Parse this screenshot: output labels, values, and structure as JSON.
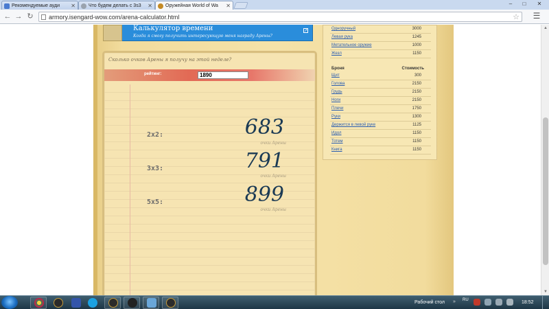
{
  "tabs": [
    {
      "label": "Рекомендуемые ауди",
      "favicon_color": "#4a7bd0"
    },
    {
      "label": "Что будем делать с 3s3",
      "favicon_color": "#9aa3ae"
    },
    {
      "label": "Оружейная World of Wa",
      "favicon_color": "#c48a25"
    }
  ],
  "window_controls": {
    "minimize": "–",
    "maximize": "□",
    "close": "✕"
  },
  "toolbar": {
    "back": "←",
    "forward": "→",
    "reload": "↻",
    "star": "☆",
    "wrench": "🔧",
    "url": "armory.isengard-wow.com/arena-calculator.html"
  },
  "header": {
    "title": "Калькулятор времени",
    "subtitle": "Когда я смогу получить интересующую меня награду Арены?",
    "external_icon": "↗"
  },
  "calculator": {
    "question": "Сколько очков Арены я получу на этой неделе?",
    "rating_label": "рейтинг:",
    "rating_value": "1890",
    "unit": "очки Арены",
    "brackets": [
      {
        "label": "2x2:",
        "points": "683"
      },
      {
        "label": "3x3:",
        "points": "791"
      },
      {
        "label": "5x5:",
        "points": "899"
      }
    ]
  },
  "weapons": [
    {
      "name": "Одноручный",
      "cost": "3000"
    },
    {
      "name": "Левая рука",
      "cost": "1245"
    },
    {
      "name": "Метательное оружие",
      "cost": "1000"
    },
    {
      "name": "Жезл",
      "cost": "1150"
    }
  ],
  "armor": {
    "col1": "Броня",
    "col2": "Стоимость",
    "items": [
      {
        "name": "Щит",
        "cost": "300"
      },
      {
        "name": "Голова",
        "cost": "2150"
      },
      {
        "name": "Грудь",
        "cost": "2150"
      },
      {
        "name": "Ноги",
        "cost": "2150"
      },
      {
        "name": "Плечи",
        "cost": "1750"
      },
      {
        "name": "Руки",
        "cost": "1300"
      },
      {
        "name": "Держится в левой руке",
        "cost": "1125"
      },
      {
        "name": "Идол",
        "cost": "1150"
      },
      {
        "name": "Тотем",
        "cost": "1150"
      },
      {
        "name": "Книга",
        "cost": "1150"
      }
    ]
  },
  "taskbar": {
    "desktop_label": "Рабочий стол",
    "language": "RU",
    "time": "18:52"
  }
}
